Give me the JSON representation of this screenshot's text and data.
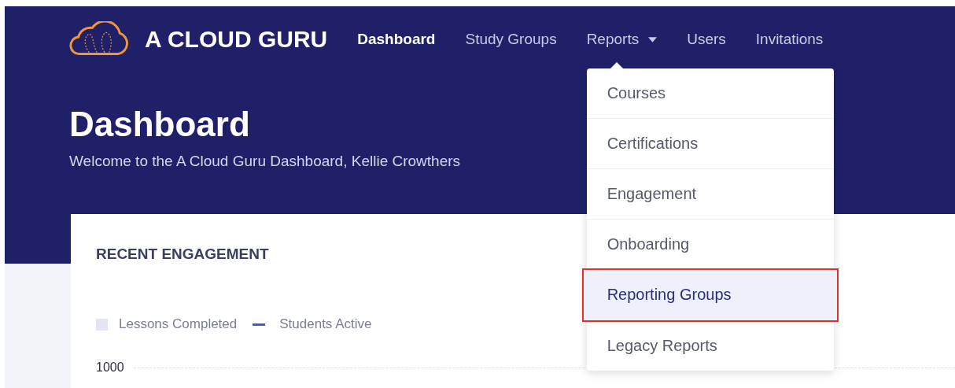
{
  "brand": {
    "name": "A CLOUD GURU"
  },
  "nav": [
    {
      "label": "Dashboard",
      "selected": true,
      "kind": "link"
    },
    {
      "label": "Study Groups",
      "selected": false,
      "kind": "link"
    },
    {
      "label": "Reports",
      "selected": false,
      "kind": "dropdown",
      "expanded": true
    },
    {
      "label": "Users",
      "selected": false,
      "kind": "link"
    },
    {
      "label": "Invitations",
      "selected": false,
      "kind": "link"
    }
  ],
  "dropdown": {
    "items": [
      {
        "label": "Courses",
        "selected": false
      },
      {
        "label": "Certifications",
        "selected": false
      },
      {
        "label": "Engagement",
        "selected": false
      },
      {
        "label": "Onboarding",
        "selected": false
      },
      {
        "label": "Reporting Groups",
        "selected": true
      },
      {
        "label": "Legacy Reports",
        "selected": false
      }
    ]
  },
  "header": {
    "title": "Dashboard",
    "subtitle": "Welcome to the A Cloud Guru Dashboard, Kellie Crowthers"
  },
  "card": {
    "title": "RECENT ENGAGEMENT",
    "legend": [
      {
        "label": "Lessons Completed",
        "kind": "square",
        "color": "#e3e5f2"
      },
      {
        "label": "Students Active",
        "kind": "line",
        "color": "#3b5bdb"
      }
    ],
    "y_tick": "1000"
  }
}
